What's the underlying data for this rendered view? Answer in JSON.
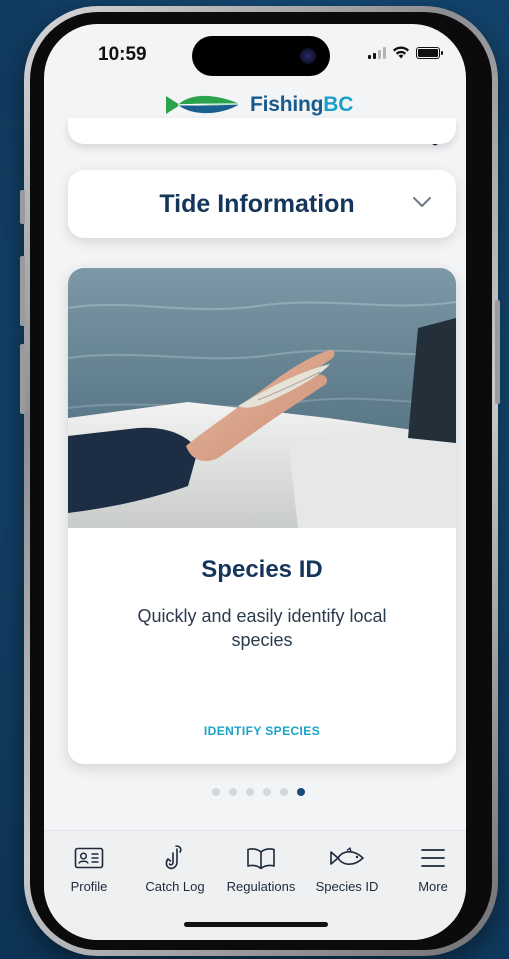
{
  "status_bar": {
    "time": "10:59"
  },
  "header": {
    "brand_main": "Fishing",
    "brand_accent": "BC",
    "notification_icon": "bell-icon"
  },
  "tide_card": {
    "title": "Tide Information",
    "toggle_icon": "chevron-down-icon"
  },
  "feature_card": {
    "title": "Species ID",
    "description": "Quickly and easily identify local species",
    "action_label": "IDENTIFY SPECIES"
  },
  "carousel": {
    "total_pages": 6,
    "active_page": 6
  },
  "tab_bar": {
    "items": [
      {
        "label": "Profile",
        "icon": "id-card-icon"
      },
      {
        "label": "Catch Log",
        "icon": "fish-hook-icon"
      },
      {
        "label": "Regulations",
        "icon": "open-book-icon"
      },
      {
        "label": "Species ID",
        "icon": "fish-outline-icon"
      },
      {
        "label": "More",
        "icon": "hamburger-menu-icon"
      }
    ]
  },
  "colors": {
    "brand_dark": "#1a5a8a",
    "brand_accent": "#1aa0c8",
    "heading": "#15355a",
    "link": "#19a3c9",
    "dot_active": "#1a4b78",
    "dot_inactive": "#d4d7dc"
  }
}
